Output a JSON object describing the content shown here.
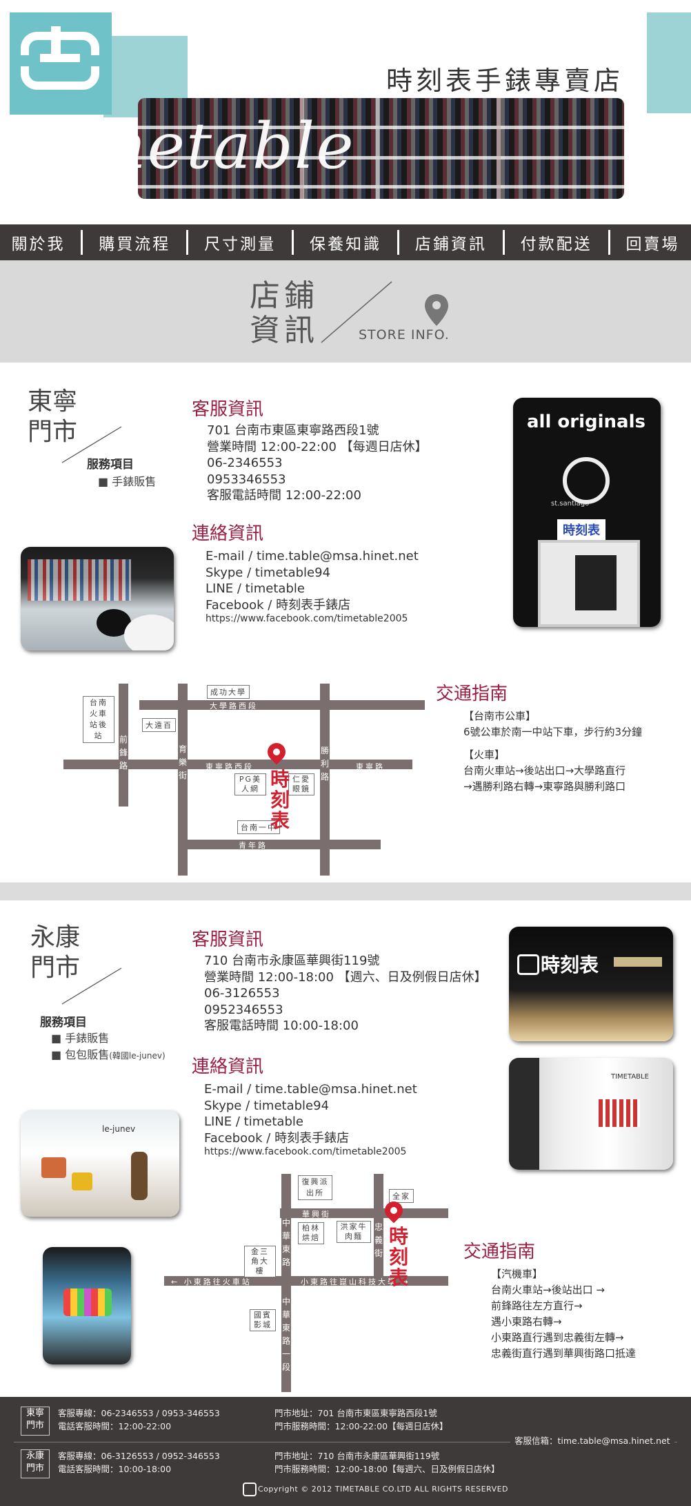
{
  "header": {
    "shop_name": "時刻表手錶專賣店",
    "script_logo": "timetable",
    "logo_icon": "clock-logo-icon"
  },
  "nav": {
    "items": [
      "關於我",
      "購買流程",
      "尺寸測量",
      "保養知識",
      "店鋪資訊",
      "付款配送",
      "回賣場"
    ]
  },
  "section": {
    "title_line1": "店鋪",
    "title_line2": "資訊",
    "subtitle": "STORE INFO.",
    "icon": "location-pin-icon"
  },
  "store1": {
    "name_line1": "東寧",
    "name_line2": "門市",
    "service_heading": "服務項目",
    "services": [
      "手錶販售"
    ],
    "cs_heading": "客服資訊",
    "cs_lines": [
      "701 台南市東區東寧路西段1號",
      "營業時間  12:00-22:00 【每週日店休】",
      "06-2346553",
      "0953346553",
      "客服電話時間  12:00-22:00"
    ],
    "contact_heading": "連絡資訊",
    "contact_lines": [
      "E-mail / time.table@msa.hinet.net",
      "Skype / timetable94",
      "LINE / timetable",
      "Facebook / 時刻表手錶店"
    ],
    "facebook_url": "https://www.facebook.com/timetable2005",
    "traffic_heading": "交通指南",
    "traffic_lines": [
      "【台南市公車】",
      "6號公車於南一中站下車，步行約3分鐘",
      "【火車】",
      "台南火車站→後站出口→大學路直行",
      "→遇勝利路右轉→東寧路與勝利路口"
    ],
    "photo_text_1": "all originals",
    "photo_text_2": "st.santiago",
    "brand_sign": "時刻表",
    "map": {
      "labels": [
        "成功大學",
        "大學路西段",
        "台南火車站後站",
        "大遠百",
        "前鋒路",
        "育樂街",
        "東寧路西段",
        "PG美人網",
        "仁愛眼鏡",
        "勝利路",
        "東寧路",
        "台南一中",
        "青年路"
      ],
      "brand": "時刻表"
    }
  },
  "store2": {
    "name_line1": "永康",
    "name_line2": "門市",
    "service_heading": "服務項目",
    "services": [
      "手錶販售",
      "包包販售"
    ],
    "service_note": "(韓國le-junev)",
    "cs_heading": "客服資訊",
    "cs_lines": [
      "710 台南市永康區華興街119號",
      "營業時間  12:00-18:00 【週六、日及例假日店休】",
      "06-3126553",
      "0952346553",
      "客服電話時間  10:00-18:00"
    ],
    "contact_heading": "連絡資訊",
    "contact_lines": [
      "E-mail / time.table@msa.hinet.net",
      "Skype / timetable94",
      "LINE / timetable",
      "Facebook / 時刻表手錶店"
    ],
    "facebook_url": "https://www.facebook.com/timetable2005",
    "traffic_heading": "交通指南",
    "traffic_lines": [
      "【汽機車】",
      "台南火車站→後站出口 →",
      "前鋒路往左方直行→",
      "遇小東路右轉→",
      "小東路直行遇到忠義街左轉→",
      "忠義街直行遇到華興街路口抵達"
    ],
    "photo_text_1": "le-junev",
    "photo_text_2": "TIMETABLE",
    "brand_sign": "時刻表",
    "map": {
      "labels": [
        "復興派出所",
        "華興街",
        "全家",
        "中華東路",
        "柏林烘焙",
        "洪家牛肉麵",
        "忠義街",
        "金三角大樓",
        "← 小東路往火車站",
        "小東路往崑山科技大學 →",
        "國賓影城",
        "中華東路一段"
      ],
      "brand": "時刻表"
    }
  },
  "footer": {
    "s1_tag": [
      "東寧",
      "門市"
    ],
    "s1_line1": "客服專線：06-2346553 / 0953-346553",
    "s1_line2": "電話客服時間：12:00-22:00",
    "s1_addr1": "門市地址：701 台南市東區東寧路西段1號",
    "s1_addr2": "門市服務時間：12:00-22:00【每週日店休】",
    "s2_tag": [
      "永康",
      "門市"
    ],
    "s2_line1": "客服專線：06-3126553 / 0952-346553",
    "s2_line2": "電話客服時間：10:00-18:00",
    "s2_addr1": "門市地址：710 台南市永康區華興街119號",
    "s2_addr2": "門市服務時間：12:00-18:00【每週六、日及例假日店休】",
    "email": "客服信箱：time.table@msa.hinet.net",
    "copyright": "Copyright © 2012 TIMETABLE CO.LTD ALL RIGHTS RESERVED"
  },
  "colors": {
    "teal": "#9ed3d6",
    "dark": "#3e3a39",
    "accent_red": "#9b1d42",
    "pin_red": "#d2202f"
  }
}
